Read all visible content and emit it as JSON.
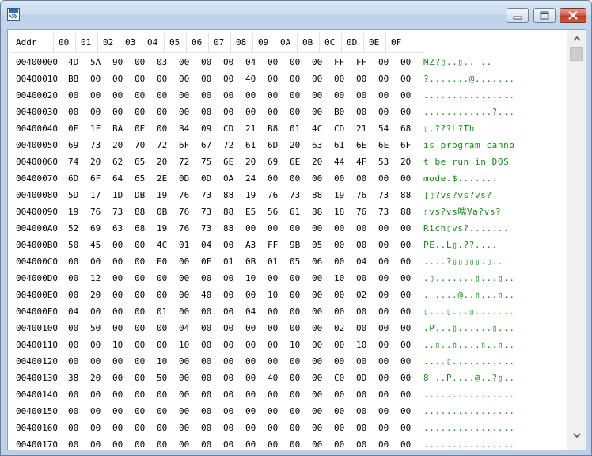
{
  "window": {
    "title": "",
    "icon": "striped-app-icon",
    "controls": [
      "minimize-icon",
      "maximize-icon",
      "close-icon"
    ]
  },
  "header": {
    "addr": "Addr",
    "cols": [
      "00",
      "01",
      "02",
      "03",
      "04",
      "05",
      "06",
      "07",
      "08",
      "09",
      "0A",
      "0B",
      "0C",
      "0D",
      "0E",
      "0F"
    ]
  },
  "rows": [
    {
      "addr": "00400000",
      "bytes": [
        "4D",
        "5A",
        "90",
        "00",
        "03",
        "00",
        "00",
        "00",
        "04",
        "00",
        "00",
        "00",
        "FF",
        "FF",
        "00",
        "00"
      ],
      "ascii": "MZ?▯..▯..    .."
    },
    {
      "addr": "00400010",
      "bytes": [
        "B8",
        "00",
        "00",
        "00",
        "00",
        "00",
        "00",
        "00",
        "40",
        "00",
        "00",
        "00",
        "00",
        "00",
        "00",
        "00"
      ],
      "ascii": "?.......@......."
    },
    {
      "addr": "00400020",
      "bytes": [
        "00",
        "00",
        "00",
        "00",
        "00",
        "00",
        "00",
        "00",
        "00",
        "00",
        "00",
        "00",
        "00",
        "00",
        "00",
        "00"
      ],
      "ascii": "................"
    },
    {
      "addr": "00400030",
      "bytes": [
        "00",
        "00",
        "00",
        "00",
        "00",
        "00",
        "00",
        "00",
        "00",
        "00",
        "00",
        "00",
        "B0",
        "00",
        "00",
        "00"
      ],
      "ascii": "............?..."
    },
    {
      "addr": "00400040",
      "bytes": [
        "0E",
        "1F",
        "BA",
        "0E",
        "00",
        "B4",
        "09",
        "CD",
        "21",
        "B8",
        "01",
        "4C",
        "CD",
        "21",
        "54",
        "68"
      ],
      "ascii": "▯.???L?Th"
    },
    {
      "addr": "00400050",
      "bytes": [
        "69",
        "73",
        "20",
        "70",
        "72",
        "6F",
        "67",
        "72",
        "61",
        "6D",
        "20",
        "63",
        "61",
        "6E",
        "6E",
        "6F"
      ],
      "ascii": "is program canno"
    },
    {
      "addr": "00400060",
      "bytes": [
        "74",
        "20",
        "62",
        "65",
        "20",
        "72",
        "75",
        "6E",
        "20",
        "69",
        "6E",
        "20",
        "44",
        "4F",
        "53",
        "20"
      ],
      "ascii": "t be run in DOS "
    },
    {
      "addr": "00400070",
      "bytes": [
        "6D",
        "6F",
        "64",
        "65",
        "2E",
        "0D",
        "0D",
        "0A",
        "24",
        "00",
        "00",
        "00",
        "00",
        "00",
        "00",
        "00"
      ],
      "ascii": "mode.$......."
    },
    {
      "addr": "00400080",
      "bytes": [
        "5D",
        "17",
        "1D",
        "DB",
        "19",
        "76",
        "73",
        "88",
        "19",
        "76",
        "73",
        "88",
        "19",
        "76",
        "73",
        "88"
      ],
      "ascii": "]▯?vs?vs?vs?"
    },
    {
      "addr": "00400090",
      "bytes": [
        "19",
        "76",
        "73",
        "88",
        "0B",
        "76",
        "73",
        "88",
        "E5",
        "56",
        "61",
        "88",
        "18",
        "76",
        "73",
        "88"
      ],
      "ascii": "▯vs?vs喘Va?vs?"
    },
    {
      "addr": "004000A0",
      "bytes": [
        "52",
        "69",
        "63",
        "68",
        "19",
        "76",
        "73",
        "88",
        "00",
        "00",
        "00",
        "00",
        "00",
        "00",
        "00",
        "00"
      ],
      "ascii": "Rich▯vs?......."
    },
    {
      "addr": "004000B0",
      "bytes": [
        "50",
        "45",
        "00",
        "00",
        "4C",
        "01",
        "04",
        "00",
        "A3",
        "FF",
        "9B",
        "05",
        "00",
        "00",
        "00",
        "00"
      ],
      "ascii": "PE..L▯.??...."
    },
    {
      "addr": "004000C0",
      "bytes": [
        "00",
        "00",
        "00",
        "00",
        "E0",
        "00",
        "0F",
        "01",
        "0B",
        "01",
        "05",
        "06",
        "00",
        "04",
        "00",
        "00"
      ],
      "ascii": "....?▯▯▯▯▯.▯.."
    },
    {
      "addr": "004000D0",
      "bytes": [
        "00",
        "12",
        "00",
        "00",
        "00",
        "00",
        "00",
        "00",
        "10",
        "00",
        "00",
        "00",
        "10",
        "00",
        "00",
        "00"
      ],
      "ascii": ".▯.......▯...▯.."
    },
    {
      "addr": "004000E0",
      "bytes": [
        "00",
        "20",
        "00",
        "00",
        "00",
        "00",
        "40",
        "00",
        "00",
        "10",
        "00",
        "00",
        "00",
        "02",
        "00",
        "00"
      ],
      "ascii": ". ....@..▯...▯.."
    },
    {
      "addr": "004000F0",
      "bytes": [
        "04",
        "00",
        "00",
        "00",
        "01",
        "00",
        "00",
        "00",
        "04",
        "00",
        "00",
        "00",
        "00",
        "00",
        "00",
        "00"
      ],
      "ascii": "▯...▯...▯......."
    },
    {
      "addr": "00400100",
      "bytes": [
        "00",
        "50",
        "00",
        "00",
        "00",
        "04",
        "00",
        "00",
        "00",
        "00",
        "00",
        "00",
        "02",
        "00",
        "00",
        "00"
      ],
      "ascii": ".P...▯......▯..."
    },
    {
      "addr": "00400110",
      "bytes": [
        "00",
        "00",
        "10",
        "00",
        "00",
        "10",
        "00",
        "00",
        "00",
        "00",
        "10",
        "00",
        "00",
        "10",
        "00",
        "00"
      ],
      "ascii": "..▯..▯....▯..▯.."
    },
    {
      "addr": "00400120",
      "bytes": [
        "00",
        "00",
        "00",
        "00",
        "10",
        "00",
        "00",
        "00",
        "00",
        "00",
        "00",
        "00",
        "00",
        "00",
        "00",
        "00"
      ],
      "ascii": "....▯..........."
    },
    {
      "addr": "00400130",
      "bytes": [
        "38",
        "20",
        "00",
        "00",
        "50",
        "00",
        "00",
        "00",
        "00",
        "40",
        "00",
        "00",
        "C0",
        "0D",
        "00",
        "00"
      ],
      "ascii": "8 ..P....@..?▯.."
    },
    {
      "addr": "00400140",
      "bytes": [
        "00",
        "00",
        "00",
        "00",
        "00",
        "00",
        "00",
        "00",
        "00",
        "00",
        "00",
        "00",
        "00",
        "00",
        "00",
        "00"
      ],
      "ascii": "................"
    },
    {
      "addr": "00400150",
      "bytes": [
        "00",
        "00",
        "00",
        "00",
        "00",
        "00",
        "00",
        "00",
        "00",
        "00",
        "00",
        "00",
        "00",
        "00",
        "00",
        "00"
      ],
      "ascii": "................"
    },
    {
      "addr": "00400160",
      "bytes": [
        "00",
        "00",
        "00",
        "00",
        "00",
        "00",
        "00",
        "00",
        "00",
        "00",
        "00",
        "00",
        "00",
        "00",
        "00",
        "00"
      ],
      "ascii": "................"
    },
    {
      "addr": "00400170",
      "bytes": [
        "00",
        "00",
        "00",
        "00",
        "00",
        "00",
        "00",
        "00",
        "00",
        "00",
        "00",
        "00",
        "00",
        "00",
        "00",
        "00"
      ],
      "ascii": "................"
    }
  ],
  "scrollbar": {
    "up_icon": "scroll-up-arrow-icon",
    "down_icon": "scroll-down-arrow-icon",
    "position": 0.0
  },
  "colors": {
    "ascii_text": "#118a11",
    "titlebar": "#c9dbef",
    "close_button": "#c3371f"
  }
}
